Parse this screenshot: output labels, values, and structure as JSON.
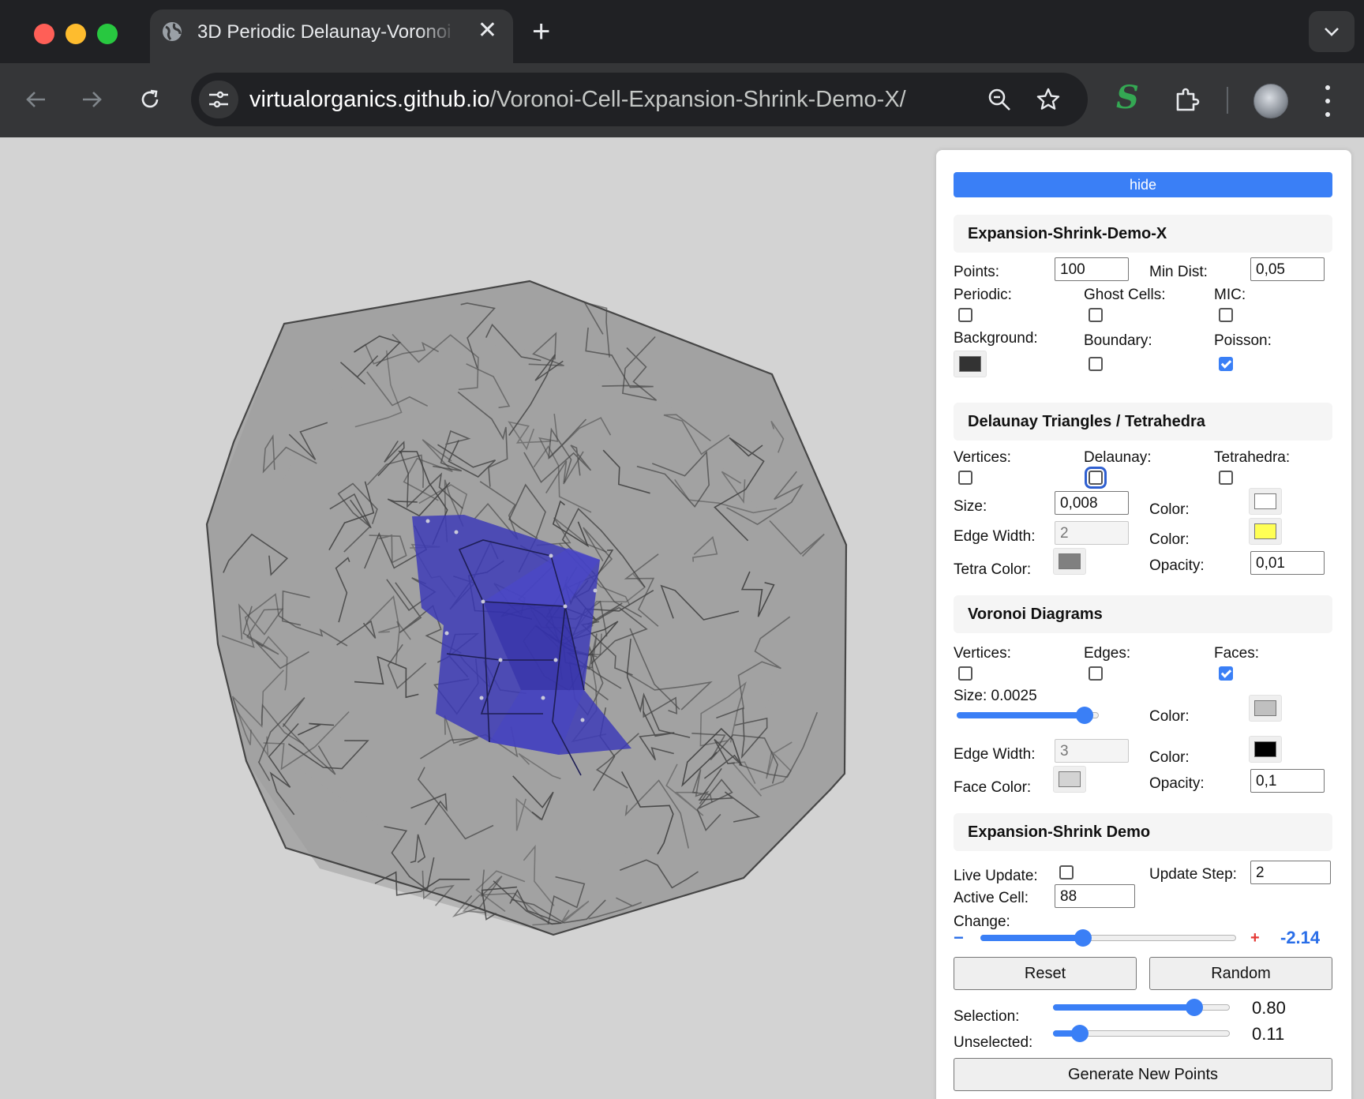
{
  "browser": {
    "tab_title": "3D Periodic Delaunay-Voronoi",
    "url_host": "virtualorganics.github.io",
    "url_path": "/Voronoi-Cell-Expansion-Shrink-Demo-X/",
    "icons": [
      "back-arrow-icon",
      "forward-arrow-icon",
      "reload-icon",
      "site-info-icon",
      "zoom-icon",
      "bookmark-star-icon",
      "extension-s-icon",
      "extensions-puzzle-icon",
      "profile-avatar",
      "more-menu-icon",
      "tab-search-chevron-icon",
      "new-tab-plus-icon"
    ]
  },
  "panel": {
    "hide_label": "hide",
    "general": {
      "title": "Expansion-Shrink-Demo-X",
      "points_label": "Points:",
      "points_value": "100",
      "min_dist_label": "Min Dist:",
      "min_dist_value": "0,05",
      "periodic_label": "Periodic:",
      "periodic_checked": false,
      "ghost_label": "Ghost Cells:",
      "ghost_checked": false,
      "mic_label": "MIC:",
      "mic_checked": false,
      "background_label": "Background:",
      "background_color": "#333333",
      "boundary_label": "Boundary:",
      "boundary_checked": false,
      "poisson_label": "Poisson:",
      "poisson_checked": true
    },
    "delaunay": {
      "title": "Delaunay Triangles / Tetrahedra",
      "vertices_label": "Vertices:",
      "vertices_checked": false,
      "delaunay_label": "Delaunay:",
      "delaunay_checked": false,
      "tetrahedra_label": "Tetrahedra:",
      "tetrahedra_checked": false,
      "size_label": "Size:",
      "size_value": "0,008",
      "color_label": "Color:",
      "vertex_color": "#ffffff",
      "edge_width_label": "Edge Width:",
      "edge_width_value": "2",
      "edge_color_label": "Color:",
      "edge_color": "#ffff55",
      "tetra_color_label": "Tetra Color:",
      "tetra_color": "#808080",
      "opacity_label": "Opacity:",
      "opacity_value": "0,01"
    },
    "voronoi": {
      "title": "Voronoi Diagrams",
      "vertices_label": "Vertices:",
      "vertices_checked": false,
      "edges_label": "Edges:",
      "edges_checked": false,
      "faces_label": "Faces:",
      "faces_checked": true,
      "size_label": "Size: 0.0025",
      "size_slider_fraction": 0.9,
      "color_label": "Color:",
      "vertex_color": "#c0c0c0",
      "edge_width_label": "Edge Width:",
      "edge_width_value": "3",
      "edge_color_label": "Color:",
      "edge_color": "#000000",
      "face_color_label": "Face Color:",
      "face_color": "#d3d3d3",
      "opacity_label": "Opacity:",
      "opacity_value": "0,1"
    },
    "demo": {
      "title": "Expansion-Shrink Demo",
      "live_update_label": "Live Update:",
      "live_update_checked": false,
      "update_step_label": "Update Step:",
      "update_step_value": "2",
      "active_cell_label": "Active Cell:",
      "active_cell_value": "88",
      "change_label": "Change:",
      "minus_symbol": "−",
      "plus_symbol": "+",
      "change_value": "-2.14",
      "change_slider_fraction": 0.4,
      "reset_label": "Reset",
      "random_label": "Random",
      "selection_label": "Selection:",
      "selection_value": "0.80",
      "selection_fraction": 0.8,
      "unselected_label": "Unselected:",
      "unselected_value": "0.11",
      "unselected_fraction": 0.15,
      "generate_label": "Generate New Points"
    }
  }
}
